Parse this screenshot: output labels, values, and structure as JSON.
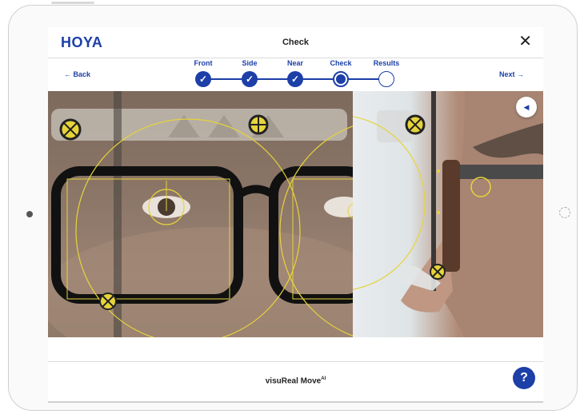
{
  "header": {
    "logo": "HOYA",
    "title": "Check",
    "close_icon": "close-icon",
    "back_label": "← Back",
    "next_label": "Next →"
  },
  "steps": [
    {
      "label": "Front",
      "state": "done",
      "icon": "check-icon"
    },
    {
      "label": "Side",
      "state": "done",
      "icon": "check-icon"
    },
    {
      "label": "Near",
      "state": "done",
      "icon": "check-icon"
    },
    {
      "label": "Check",
      "state": "active",
      "icon": "filled-dot-icon"
    },
    {
      "label": "Results",
      "state": "todo",
      "icon": "empty-circle-icon"
    }
  ],
  "media": {
    "front_image": "front-face-measurement-photo",
    "side_image": "side-face-measurement-photo",
    "play_icon": "play-icon",
    "play_symbol": "◀"
  },
  "footer": {
    "product_name": "visuReal Move",
    "superscript": "AI",
    "help_symbol": "?"
  },
  "colors": {
    "brand": "#1c3fa8",
    "overlay": "#e6d43a"
  }
}
